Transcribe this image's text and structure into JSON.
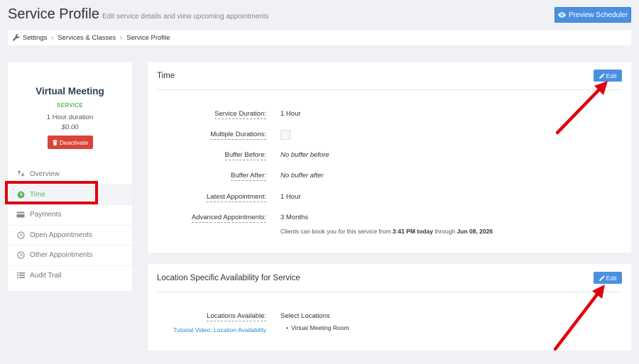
{
  "header": {
    "title": "Service Profile",
    "subtitle": "Edit service details and view upcoming appointments",
    "preview_button": "Preview Scheduler"
  },
  "breadcrumb": {
    "items": [
      "Settings",
      "Services & Classes",
      "Service Profile"
    ]
  },
  "service": {
    "name": "Virtual Meeting",
    "tag": "SERVICE",
    "duration": "1 Hour duration",
    "price": "$0.00",
    "deactivate_label": "Deactivate"
  },
  "nav": {
    "items": [
      {
        "label": "Overview",
        "icon": "overview-icon"
      },
      {
        "label": "Time",
        "icon": "clock-icon",
        "active": true
      },
      {
        "label": "Payments",
        "icon": "credit-card-icon"
      },
      {
        "label": "Open Appointments",
        "icon": "clock-outline-icon"
      },
      {
        "label": "Other Appointments",
        "icon": "clock-outline-icon"
      },
      {
        "label": "Audit Trail",
        "icon": "list-icon"
      }
    ]
  },
  "time_card": {
    "title": "Time",
    "edit_label": "Edit",
    "rows": [
      {
        "label": "Service Duration:",
        "value": "1 Hour"
      },
      {
        "label": "Multiple Durations:",
        "value": ""
      },
      {
        "label": "Buffer Before:",
        "value": "No buffer before"
      },
      {
        "label": "Buffer After:",
        "value": "No buffer after"
      },
      {
        "label": "Latest Appointment:",
        "value": "1 Hour"
      },
      {
        "label": "Advanced Appointments:",
        "value": "3 Months"
      }
    ],
    "note": {
      "prefix": "Clients can book you for this service from ",
      "from": "3:41 PM today",
      "middle": " through ",
      "to": "Jun 08, 2026"
    }
  },
  "location_card": {
    "title": "Location Specific Availability for Service",
    "edit_label": "Edit",
    "label": "Locations Available:",
    "value": "Select Locations",
    "tutorial_link": "Tutorial Video: Location Availability",
    "locations": [
      "Virtual Meeting Room"
    ]
  },
  "colors": {
    "accent_blue": "#4a90e2",
    "danger_red": "#d9433a",
    "success_green": "#5cb85c",
    "annotation_red": "#e0000f"
  }
}
